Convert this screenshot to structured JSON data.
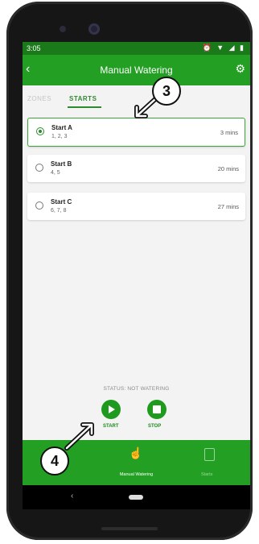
{
  "status_bar": {
    "time": "3:05",
    "icons": "⏰ ▼ ◢ ▮"
  },
  "app_bar": {
    "title": "Manual Watering",
    "back_icon": "chevron-left-icon",
    "settings_icon": "gear-icon"
  },
  "tabs": [
    {
      "label": "ZONES",
      "active": false
    },
    {
      "label": "STARTS",
      "active": true
    }
  ],
  "starts": [
    {
      "name": "Start A",
      "zones": "1, 2, 3",
      "duration": "3 mins",
      "selected": true
    },
    {
      "name": "Start B",
      "zones": "4, 5",
      "duration": "20 mins",
      "selected": false
    },
    {
      "name": "Start C",
      "zones": "6, 7, 8",
      "duration": "27 mins",
      "selected": false
    }
  ],
  "status_text": "STATUS: NOT WATERING",
  "controls": {
    "start_label": "START",
    "stop_label": "STOP"
  },
  "bottom_nav": [
    {
      "label": "Manual Watering",
      "icon": "hand-pointer-icon",
      "active": true
    },
    {
      "label": "Starts",
      "icon": "starts-list-icon",
      "active": false
    }
  ],
  "callouts": {
    "top": "3",
    "bottom": "4"
  },
  "colors": {
    "brand_green": "#23a023",
    "dark_green": "#1a7a1a",
    "accent": "#2e8a2e"
  }
}
